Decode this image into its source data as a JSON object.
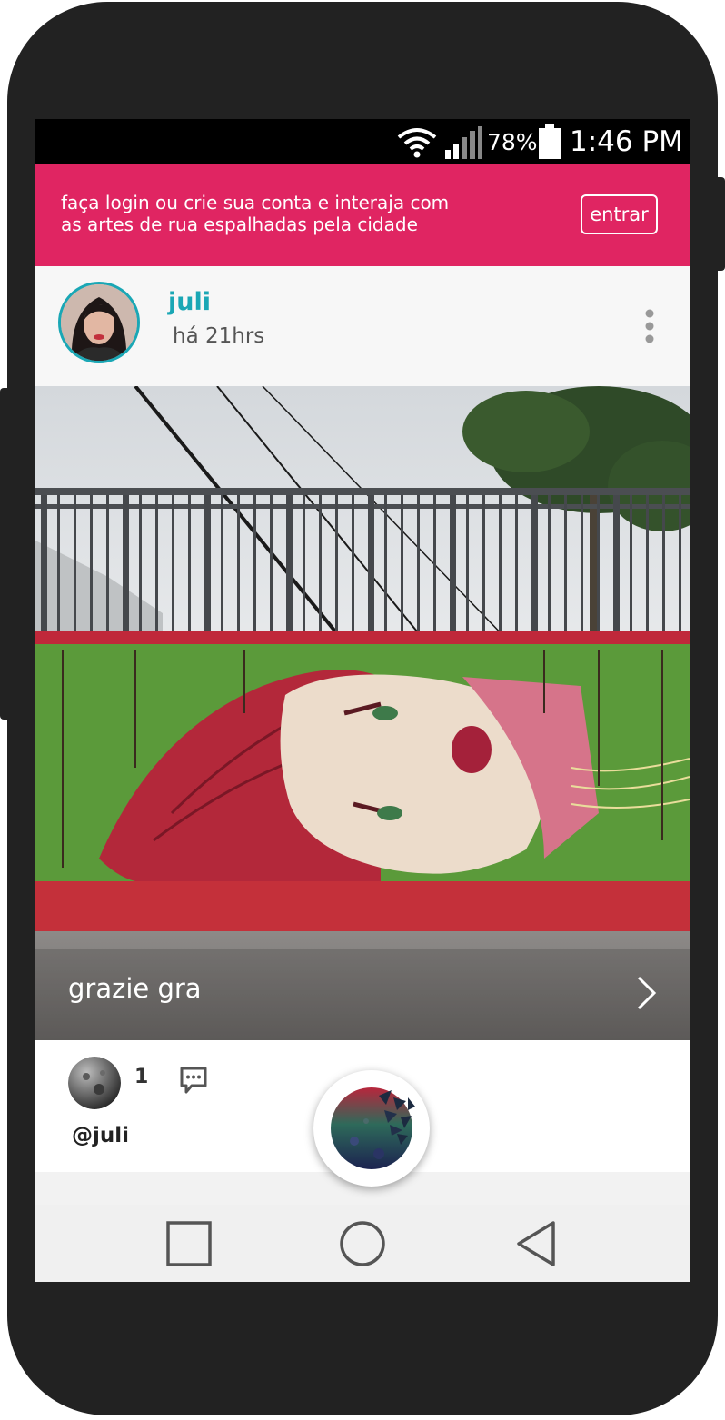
{
  "status_bar": {
    "battery_percent": "78%",
    "time": "1:46 PM",
    "icons": [
      "wifi-icon",
      "signal-icon",
      "battery-icon"
    ]
  },
  "banner": {
    "message": "faça login ou crie sua conta e interaja com as artes de rua espalhadas pela cidade",
    "button_label": "entrar",
    "color": "#e02562"
  },
  "post": {
    "author": "juli",
    "time_ago": "há 21hrs",
    "image_caption": "grazie gra",
    "like_count": "1",
    "author_handle": "@juli",
    "accent_color": "#1aa7b5"
  },
  "navigation": {
    "buttons": [
      "recents-icon",
      "home-icon",
      "back-icon"
    ]
  }
}
